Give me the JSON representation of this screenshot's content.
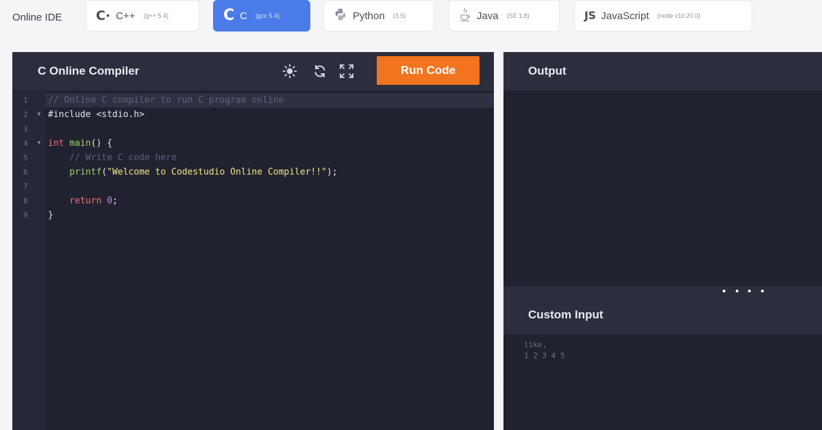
{
  "brand": "Online IDE",
  "languages": [
    {
      "name": "C++",
      "version": "(g++ 5.4)",
      "icon": "c-plus-plus-icon"
    },
    {
      "name": "C",
      "version": "(gcc 5.4)",
      "icon": "c-icon",
      "active": true
    },
    {
      "name": "Python",
      "version": "(3.5)",
      "icon": "python-icon"
    },
    {
      "name": "Java",
      "version": "(SE 1.8)",
      "icon": "java-icon"
    },
    {
      "name": "JavaScript",
      "version": "(node v10.20.0)",
      "icon": "javascript-icon"
    }
  ],
  "editor": {
    "title": "C Online Compiler",
    "run_label": "Run Code",
    "toolbar_icons": [
      "brightness-icon",
      "reset-icon",
      "fullscreen-icon"
    ],
    "line_numbers": [
      "1",
      "2",
      "3",
      "4",
      "5",
      "6",
      "7",
      "8",
      "9"
    ],
    "code": [
      "// Online C compiler to run C program online",
      "#include <stdio.h>",
      "",
      "int main() {",
      "    // Write C code here",
      "    printf(\"Welcome to Codestudio Online Compiler!!\");",
      "",
      "    return 0;",
      "}"
    ],
    "active_line": 1
  },
  "output": {
    "title": "Output"
  },
  "custom_input": {
    "title": "Custom Input",
    "placeholder_lines": [
      "like,",
      "1 2 3 4 5"
    ]
  },
  "colors": {
    "accent": "#4a7be8",
    "run_button": "#f2741f",
    "editor_bg": "#21222f",
    "header_bg": "#2c2e3e"
  }
}
